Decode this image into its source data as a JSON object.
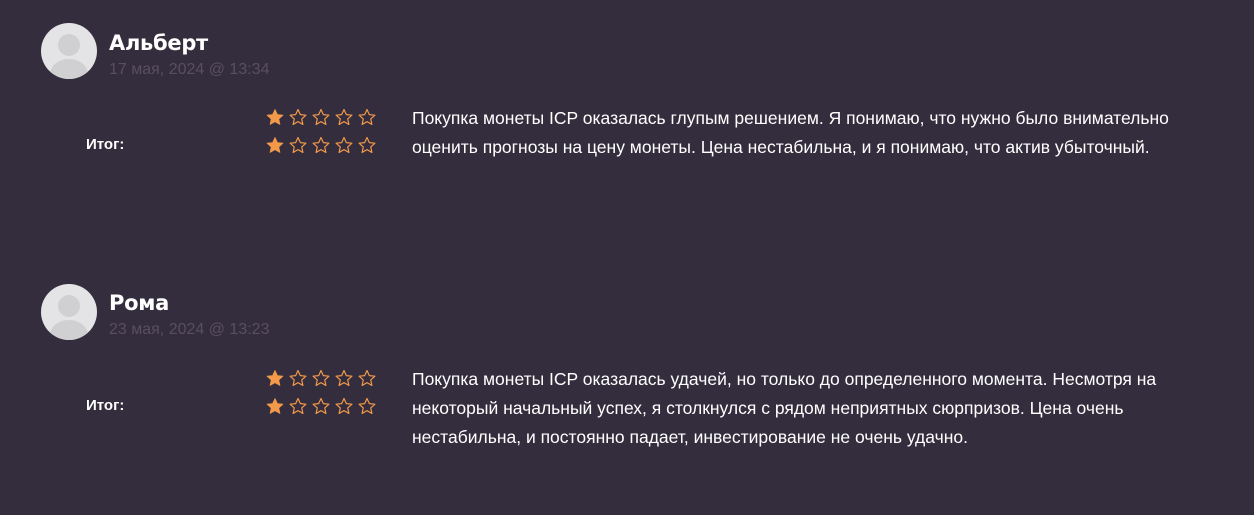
{
  "colors": {
    "background": "#342d3d",
    "star_filled": "#f2994a",
    "star_outline": "#f2994a",
    "date_text": "#58505f"
  },
  "reviews": [
    {
      "author": "Альберт",
      "date": "17 мая, 2024 @ 13:34",
      "total_label": "Итог:",
      "rating_rows": [
        {
          "value": 1,
          "max": 5
        },
        {
          "value": 1,
          "max": 5
        }
      ],
      "text": "Покупка монеты ICP оказалась глупым решением. Я понимаю, что нужно было внимательно оценить прогнозы на цену монеты. Цена нестабильна, и я понимаю, что актив убыточный."
    },
    {
      "author": "Рома",
      "date": "23 мая, 2024 @ 13:23",
      "total_label": "Итог:",
      "rating_rows": [
        {
          "value": 1,
          "max": 5
        },
        {
          "value": 1,
          "max": 5
        }
      ],
      "text": "Покупка монеты ICP оказалась удачей, но только до определенного момента. Несмотря на некоторый начальный успех, я столкнулся с рядом неприятных сюрпризов. Цена очень нестабильна, и постоянно падает, инвестирование не очень удачно."
    }
  ]
}
